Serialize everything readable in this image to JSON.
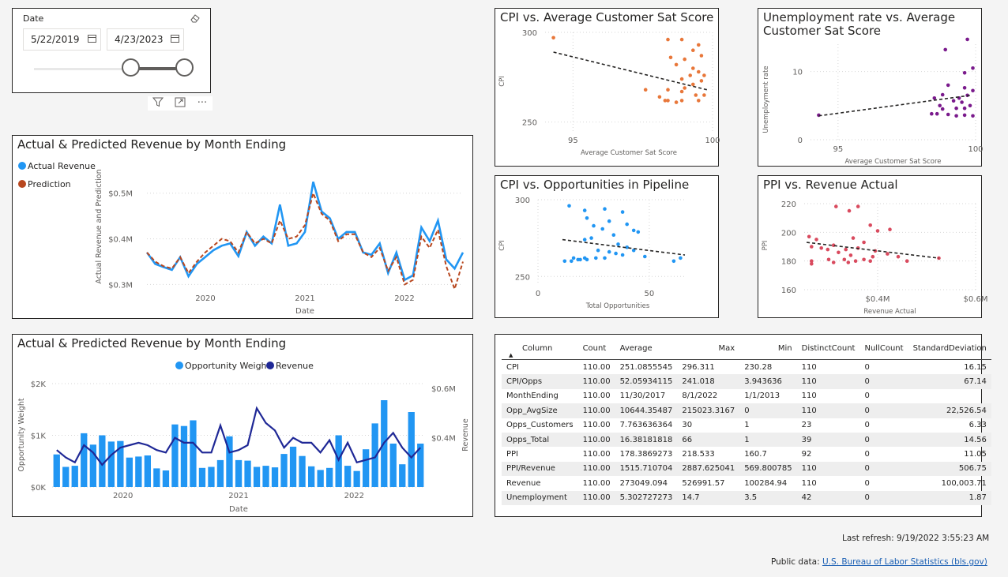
{
  "date_slicer": {
    "title": "Date",
    "start_date": "5/22/2019",
    "end_date": "4/23/2023",
    "range_fraction": [
      0.62,
      1.0
    ]
  },
  "visual_header_icons": [
    "filter-icon",
    "focus-mode-icon",
    "more-options-icon"
  ],
  "colors": {
    "actual": "#2196f3",
    "prediction": "#b8471f",
    "opportunity_weight": "#2196f3",
    "revenue_line": "#1f2896",
    "cpi_sat": "#e8773a",
    "unemp_sat": "#7a1a8c",
    "cpi_opps": "#2196f3",
    "ppi_rev": "#d94a5e"
  },
  "charts": {
    "revenue_line": {
      "title": "Actual & Predicted Revenue by Month Ending",
      "legend": [
        "Actual Revenue",
        "Prediction"
      ],
      "ylabel": "Actual Revenue and Prediction",
      "xlabel": "Date",
      "yticks": [
        "$0.5M",
        "$0.4M",
        "$0.3M"
      ],
      "xticks": [
        "2020",
        "2021",
        "2022"
      ]
    },
    "opportunity_combo": {
      "title": "Actual & Predicted Revenue by Month Ending",
      "legend": [
        "Opportunity Weight",
        "Revenue"
      ],
      "ylabel_left": "Opportunity Weight",
      "ylabel_right": "Revenue",
      "xlabel": "Date",
      "yticks_left": [
        "$2K",
        "$1K",
        "$0K"
      ],
      "yticks_right": [
        "$0.6M",
        "$0.4M"
      ],
      "xticks": [
        "2020",
        "2021",
        "2022"
      ]
    },
    "cpi_sat": {
      "title": "CPI vs. Average Customer Sat Score",
      "xlabel": "Average Customer Sat Score",
      "ylabel": "CPI",
      "xticks": [
        "95",
        "100"
      ],
      "yticks": [
        "300",
        "250"
      ]
    },
    "unemp_sat": {
      "title": "Unemployment rate vs. Average\nCustomer Sat Score",
      "xlabel": "Average Customer Sat Score",
      "ylabel": "Unemployment rate",
      "xticks": [
        "95",
        "100"
      ],
      "yticks": [
        "10",
        "0"
      ]
    },
    "cpi_opps": {
      "title": "CPI vs. Opportunities in Pipeline",
      "xlabel": "Total Opportunities",
      "ylabel": "CPI",
      "xticks": [
        "0",
        "50"
      ],
      "yticks": [
        "300",
        "250"
      ]
    },
    "ppi_rev": {
      "title": "PPI vs. Revenue Actual",
      "xlabel": "Revenue Actual",
      "ylabel": "PPI",
      "xticks": [
        "$0.4M",
        "$0.6M"
      ],
      "yticks": [
        "220",
        "200",
        "180",
        "160"
      ]
    }
  },
  "chart_data": [
    {
      "type": "line",
      "title": "Actual & Predicted Revenue by Month Ending",
      "xlabel": "Date",
      "ylabel": "Actual Revenue and Prediction",
      "x_range": [
        "2019-05",
        "2023-04"
      ],
      "ylim": [
        0.28,
        0.56
      ],
      "series": [
        {
          "name": "Actual Revenue",
          "values": [
            0.37,
            0.345,
            0.338,
            0.332,
            0.36,
            0.318,
            0.345,
            0.36,
            0.375,
            0.385,
            0.39,
            0.362,
            0.415,
            0.385,
            0.405,
            0.39,
            0.475,
            0.385,
            0.39,
            0.415,
            0.525,
            0.46,
            0.445,
            0.4,
            0.415,
            0.415,
            0.37,
            0.365,
            0.39,
            0.325,
            0.37,
            0.31,
            0.32,
            0.425,
            0.395,
            0.44,
            0.355,
            0.335,
            0.37
          ]
        },
        {
          "name": "Prediction",
          "values": [
            0.37,
            0.35,
            0.34,
            0.335,
            0.36,
            0.325,
            0.35,
            0.37,
            0.385,
            0.4,
            0.395,
            0.37,
            0.415,
            0.39,
            0.4,
            0.39,
            0.44,
            0.4,
            0.405,
            0.43,
            0.5,
            0.455,
            0.44,
            0.395,
            0.41,
            0.41,
            0.37,
            0.36,
            0.38,
            0.33,
            0.36,
            0.3,
            0.31,
            0.405,
            0.38,
            0.42,
            0.34,
            0.29,
            0.35
          ]
        }
      ]
    },
    {
      "type": "bar",
      "title": "Actual & Predicted Revenue by Month Ending",
      "xlabel": "Date",
      "x_range": [
        "2019-05",
        "2023-04"
      ],
      "series": [
        {
          "name": "Opportunity Weight",
          "axis": "left",
          "ylim": [
            0,
            2000
          ],
          "values": [
            630,
            390,
            410,
            1040,
            820,
            1000,
            880,
            890,
            570,
            590,
            610,
            360,
            320,
            1210,
            1180,
            1290,
            370,
            390,
            520,
            980,
            520,
            510,
            390,
            410,
            380,
            640,
            780,
            600,
            400,
            330,
            370,
            1000,
            410,
            310,
            730,
            1230,
            1680,
            840,
            440,
            1450,
            840
          ]
        },
        {
          "name": "Revenue",
          "axis": "right",
          "ylim": [
            0.2,
            0.62
          ],
          "values": [
            0.35,
            0.32,
            0.3,
            0.37,
            0.34,
            0.29,
            0.33,
            0.36,
            0.37,
            0.38,
            0.37,
            0.35,
            0.34,
            0.4,
            0.38,
            0.38,
            0.34,
            0.34,
            0.45,
            0.34,
            0.35,
            0.37,
            0.52,
            0.46,
            0.43,
            0.36,
            0.4,
            0.38,
            0.38,
            0.34,
            0.39,
            0.31,
            0.38,
            0.3,
            0.31,
            0.32,
            0.38,
            0.42,
            0.36,
            0.32,
            0.36
          ]
        }
      ]
    },
    {
      "type": "scatter",
      "title": "CPI vs. Average Customer Sat Score",
      "xlabel": "Average Customer Sat Score",
      "ylabel": "CPI",
      "xlim": [
        94,
        100
      ],
      "ylim": [
        245,
        300
      ],
      "points": [
        [
          94.3,
          297
        ],
        [
          98.4,
          296
        ],
        [
          98.9,
          296
        ],
        [
          99.5,
          293
        ],
        [
          99.3,
          290
        ],
        [
          99.6,
          287
        ],
        [
          98.5,
          286
        ],
        [
          99.0,
          285
        ],
        [
          98.7,
          282
        ],
        [
          99.3,
          280
        ],
        [
          99.5,
          278
        ],
        [
          99.7,
          276
        ],
        [
          99.2,
          276
        ],
        [
          98.9,
          274
        ],
        [
          99.6,
          273
        ],
        [
          99.3,
          271
        ],
        [
          99.0,
          269
        ],
        [
          98.4,
          268
        ],
        [
          98.9,
          267
        ],
        [
          99.4,
          265
        ],
        [
          99.7,
          265
        ],
        [
          97.6,
          268
        ],
        [
          98.1,
          264
        ],
        [
          98.4,
          262
        ],
        [
          98.9,
          262
        ],
        [
          99.5,
          262
        ],
        [
          98.3,
          262
        ],
        [
          98.7,
          261
        ]
      ],
      "trendline": [
        [
          94.3,
          289
        ],
        [
          99.8,
          268
        ]
      ]
    },
    {
      "type": "scatter",
      "title": "Unemployment rate vs. Average Customer Sat Score",
      "xlabel": "Average Customer Sat Score",
      "ylabel": "Unemployment rate",
      "xlim": [
        94,
        100
      ],
      "ylim": [
        0,
        14
      ],
      "points": [
        [
          94.3,
          3.6
        ],
        [
          98.9,
          13.2
        ],
        [
          99.7,
          14.7
        ],
        [
          99.0,
          8.0
        ],
        [
          99.9,
          10.5
        ],
        [
          99.6,
          9.8
        ],
        [
          99.6,
          7.6
        ],
        [
          99.9,
          7.2
        ],
        [
          98.5,
          6.1
        ],
        [
          98.8,
          6.6
        ],
        [
          99.4,
          6.1
        ],
        [
          99.7,
          6.5
        ],
        [
          99.2,
          5.7
        ],
        [
          99.5,
          5.5
        ],
        [
          98.7,
          5.0
        ],
        [
          99.8,
          5.0
        ],
        [
          99.3,
          4.6
        ],
        [
          98.8,
          4.5
        ],
        [
          99.6,
          4.6
        ],
        [
          98.6,
          3.8
        ],
        [
          99.0,
          3.7
        ],
        [
          99.6,
          3.6
        ],
        [
          99.3,
          3.5
        ],
        [
          98.4,
          3.8
        ],
        [
          99.9,
          3.5
        ]
      ],
      "trendline": [
        [
          94.3,
          3.5
        ],
        [
          99.8,
          6.5
        ]
      ]
    },
    {
      "type": "scatter",
      "title": "CPI vs. Opportunities in Pipeline",
      "xlabel": "Total Opportunities",
      "ylabel": "CPI",
      "xlim": [
        0,
        66
      ],
      "ylim": [
        245,
        300
      ],
      "points": [
        [
          14,
          296
        ],
        [
          21,
          293
        ],
        [
          22,
          288
        ],
        [
          30,
          294
        ],
        [
          38,
          292
        ],
        [
          32,
          286
        ],
        [
          40,
          284
        ],
        [
          25,
          283
        ],
        [
          29,
          281
        ],
        [
          43,
          280
        ],
        [
          45,
          279
        ],
        [
          34,
          277
        ],
        [
          24,
          275
        ],
        [
          21,
          274
        ],
        [
          36,
          271
        ],
        [
          40,
          269
        ],
        [
          27,
          267
        ],
        [
          43,
          267
        ],
        [
          32,
          266
        ],
        [
          35,
          265
        ],
        [
          38,
          264
        ],
        [
          48,
          263
        ],
        [
          16,
          262
        ],
        [
          21,
          262
        ],
        [
          26,
          262
        ],
        [
          30,
          262
        ],
        [
          19,
          261
        ],
        [
          12,
          260
        ],
        [
          15,
          260
        ],
        [
          18,
          261
        ],
        [
          22,
          261
        ],
        [
          64,
          262
        ],
        [
          61,
          260
        ]
      ],
      "trendline": [
        [
          11,
          274
        ],
        [
          66,
          264
        ]
      ]
    },
    {
      "type": "scatter",
      "title": "PPI vs. Revenue Actual",
      "xlabel": "Revenue Actual",
      "ylabel": "PPI",
      "xlim": [
        0.25,
        0.6
      ],
      "ylim": [
        160,
        220
      ],
      "points": [
        [
          0.315,
          218
        ],
        [
          0.36,
          218
        ],
        [
          0.342,
          215
        ],
        [
          0.385,
          205
        ],
        [
          0.4,
          201
        ],
        [
          0.425,
          202
        ],
        [
          0.26,
          197
        ],
        [
          0.275,
          195
        ],
        [
          0.35,
          196
        ],
        [
          0.372,
          193
        ],
        [
          0.31,
          191
        ],
        [
          0.265,
          190
        ],
        [
          0.285,
          189
        ],
        [
          0.36,
          189
        ],
        [
          0.335,
          188
        ],
        [
          0.298,
          188
        ],
        [
          0.395,
          187
        ],
        [
          0.32,
          186
        ],
        [
          0.42,
          185
        ],
        [
          0.345,
          184
        ],
        [
          0.39,
          183
        ],
        [
          0.442,
          183
        ],
        [
          0.3,
          181
        ],
        [
          0.265,
          180
        ],
        [
          0.332,
          181
        ],
        [
          0.372,
          181
        ],
        [
          0.355,
          180
        ],
        [
          0.385,
          180
        ],
        [
          0.46,
          180
        ],
        [
          0.34,
          179
        ],
        [
          0.31,
          179
        ],
        [
          0.265,
          178
        ],
        [
          0.525,
          182
        ]
      ],
      "trendline": [
        [
          0.255,
          193
        ],
        [
          0.525,
          182
        ]
      ]
    }
  ],
  "stats_table": {
    "columns": [
      "Column",
      "Count",
      "Average",
      "Max",
      "Min",
      "DistinctCount",
      "NullCount",
      "StandardDeviation"
    ],
    "rows": [
      [
        "CPI",
        "110.00",
        "251.0855545",
        "296.311",
        "230.28",
        "110",
        "0",
        "16.15"
      ],
      [
        "CPI/Opps",
        "110.00",
        "52.05934115",
        "241.018",
        "3.943636",
        "110",
        "0",
        "67.14"
      ],
      [
        "MonthEnding",
        "110.00",
        "11/30/2017",
        "8/1/2022",
        "1/1/2013",
        "110",
        "0",
        ""
      ],
      [
        "Opp_AvgSize",
        "110.00",
        "10644.35487",
        "215023.3167",
        "0",
        "110",
        "0",
        "22,526.54"
      ],
      [
        "Opps_Customers",
        "110.00",
        "7.763636364",
        "30",
        "1",
        "23",
        "0",
        "6.33"
      ],
      [
        "Opps_Total",
        "110.00",
        "16.38181818",
        "66",
        "1",
        "39",
        "0",
        "14.56"
      ],
      [
        "PPI",
        "110.00",
        "178.3869273",
        "218.533",
        "160.7",
        "92",
        "0",
        "11.05"
      ],
      [
        "PPI/Revenue",
        "110.00",
        "1515.710704",
        "2887.625041",
        "569.800785",
        "110",
        "0",
        "506.75"
      ],
      [
        "Revenue",
        "110.00",
        "273049.094",
        "526991.57",
        "100284.94",
        "110",
        "0",
        "100,003.71"
      ],
      [
        "Unemployment",
        "110.00",
        "5.302727273",
        "14.7",
        "3.5",
        "42",
        "0",
        "1.87"
      ]
    ]
  },
  "footer": {
    "last_refresh": "Last refresh: 9/19/2022 3:55:23 AM",
    "public_data_prefix": "Public data: ",
    "public_data_link": "U.S. Bureau of Labor Statistics (bls.gov)"
  }
}
